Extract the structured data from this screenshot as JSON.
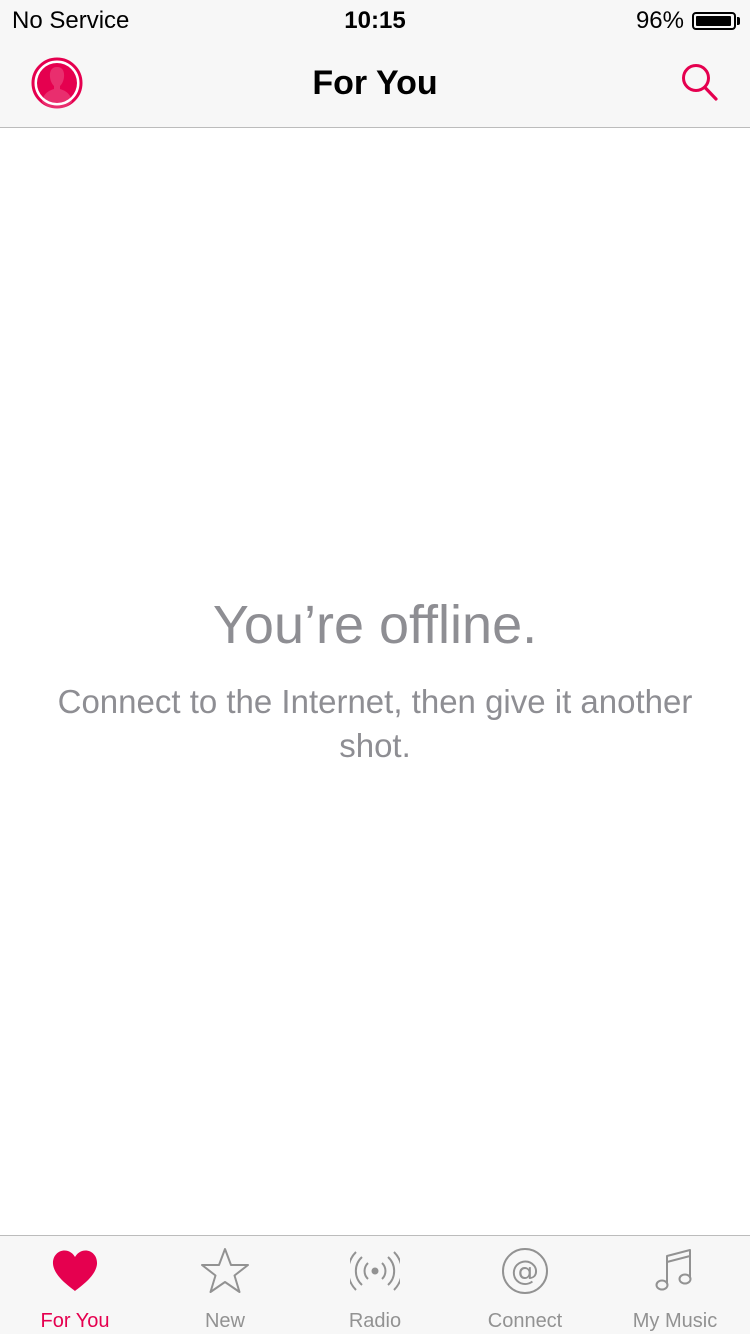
{
  "status_bar": {
    "carrier": "No Service",
    "time": "10:15",
    "battery_percent": "96%",
    "battery_level": 0.96
  },
  "nav_bar": {
    "title": "For You",
    "left_icon": "profile-icon",
    "right_icon": "search-icon"
  },
  "content": {
    "title": "You’re offline.",
    "message": "Connect to the Internet, then give it another shot."
  },
  "tab_bar": {
    "items": [
      {
        "label": "For You",
        "icon": "heart-icon",
        "active": true
      },
      {
        "label": "New",
        "icon": "star-icon",
        "active": false
      },
      {
        "label": "Radio",
        "icon": "radio-icon",
        "active": false
      },
      {
        "label": "Connect",
        "icon": "at-icon",
        "active": false
      },
      {
        "label": "My Music",
        "icon": "music-note-icon",
        "active": false
      }
    ]
  },
  "colors": {
    "accent": "#e5004f",
    "inactive": "#929292",
    "secondary_text": "#8e8e93",
    "bar_background": "#f7f7f7"
  }
}
